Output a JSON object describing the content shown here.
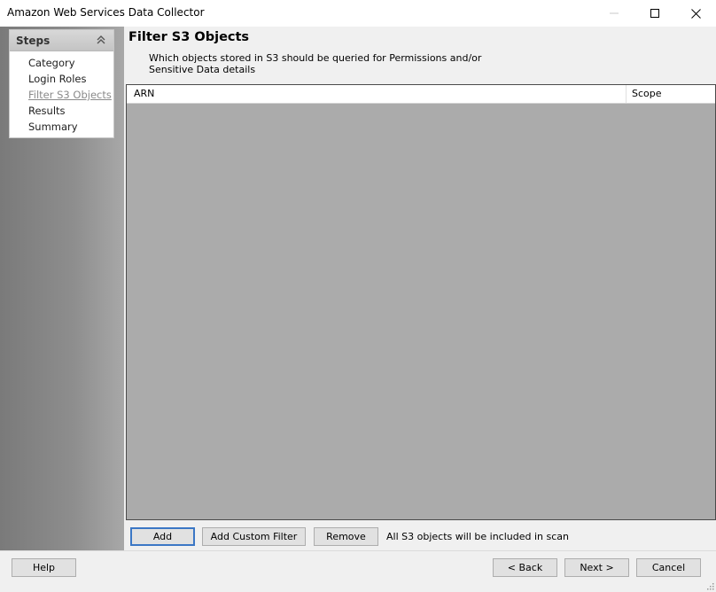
{
  "window": {
    "title": "Amazon Web Services Data Collector",
    "controls": [
      "minimize-icon",
      "maximize-icon",
      "close-icon"
    ]
  },
  "steps": {
    "header": "Steps",
    "collapse_icon": "double-chevron-up-icon",
    "items": [
      {
        "label": "Category",
        "state": "done"
      },
      {
        "label": "Login Roles",
        "state": "done"
      },
      {
        "label": "Filter S3 Objects",
        "state": "current"
      },
      {
        "label": "Results",
        "state": "pending"
      },
      {
        "label": "Summary",
        "state": "pending"
      }
    ]
  },
  "page": {
    "title": "Filter S3 Objects",
    "description": "Which objects stored in S3 should be queried for Permissions and/or Sensitive Data details"
  },
  "grid": {
    "columns": [
      "ARN",
      "Scope"
    ],
    "rows": []
  },
  "actions": {
    "add": "Add",
    "add_custom_filter": "Add Custom Filter",
    "remove": "Remove",
    "status": "All S3 objects will be included in scan"
  },
  "footer": {
    "help": "Help",
    "back": "< Back",
    "next": "Next >",
    "cancel": "Cancel"
  },
  "colors": {
    "accent_border": "#3b77c5",
    "grid_background": "#ababab"
  }
}
